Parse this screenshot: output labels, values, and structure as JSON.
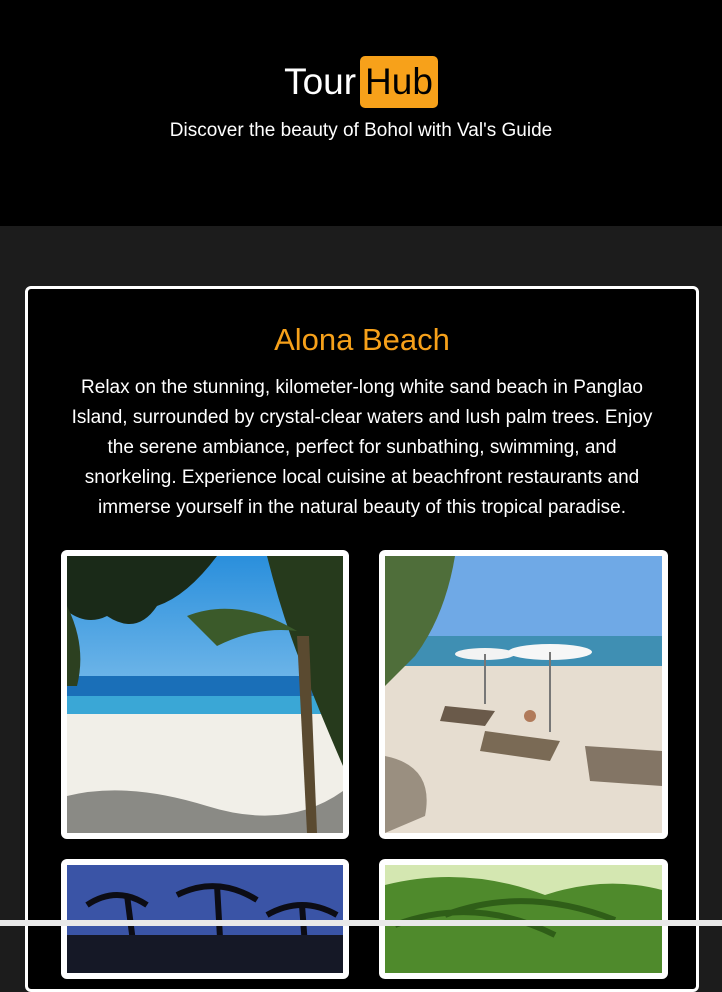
{
  "header": {
    "logo_tour": "Tour",
    "logo_hub": "Hub",
    "tagline": "Discover the beauty of Bohol with Val's Guide"
  },
  "destination": {
    "title": "Alona Beach",
    "description": "Relax on the stunning, kilometer-long white sand beach in Panglao Island, surrounded by crystal-clear waters and lush palm trees. Enjoy the serene ambiance, perfect for sunbathing, swimming, and snorkeling. Experience local cuisine at beachfront restaurants and immerse yourself in the natural beauty of this tropical paradise."
  },
  "colors": {
    "accent": "#f7a11a",
    "header_bg": "#000000",
    "page_bg": "#1c1c1c",
    "card_bg": "#000000"
  }
}
